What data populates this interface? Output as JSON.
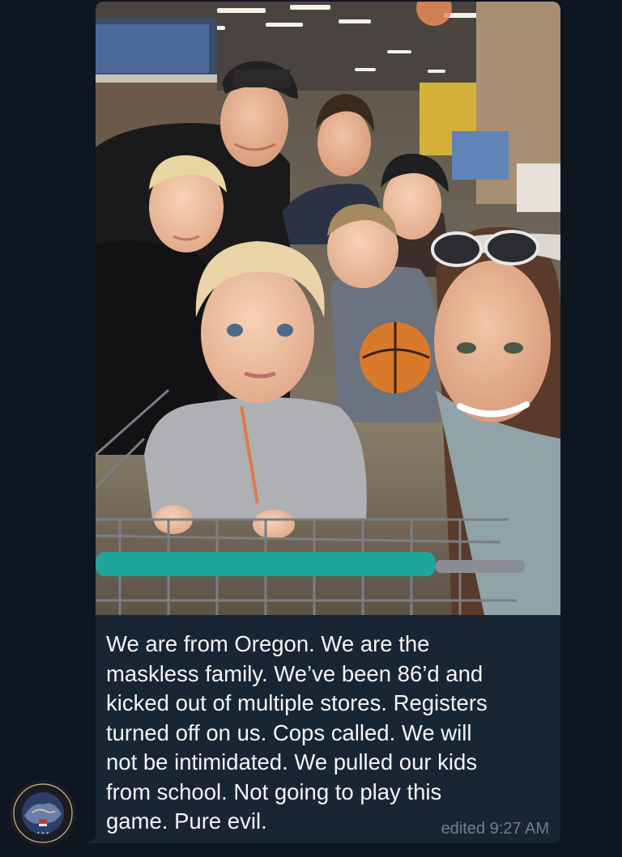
{
  "message": {
    "text": "We are from Oregon. We are the\nmaskless family. We’ve been 86’d and\nkicked out of multiple stores. Registers\nturned off on us. Cops called. We will\nnot be intimidated. We pulled our kids\nfrom school. Not going to play this\ngame. Pure evil.",
    "status": "edited 9:27 AM",
    "photo_icon": "family-selfie-photo"
  },
  "sender": {
    "avatar_icon": "circular-emblem-icon"
  },
  "colors": {
    "background": "#0e1621",
    "bubble": "#182533",
    "text": "#f5f5f5",
    "meta": "#6d7f8f"
  }
}
